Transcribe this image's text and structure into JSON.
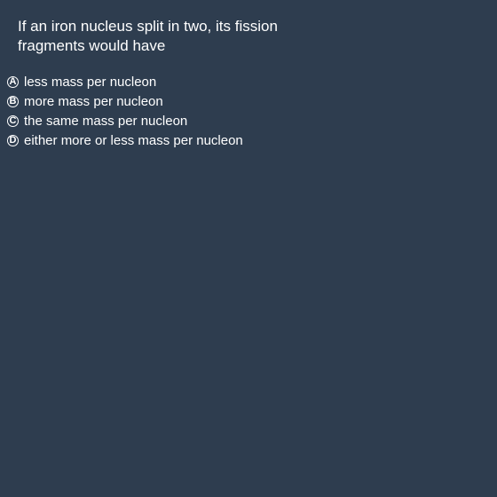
{
  "question": {
    "text": "If an iron nucleus split in two, its fission fragments would have"
  },
  "options": [
    {
      "letter": "A",
      "label": "less mass per nucleon"
    },
    {
      "letter": "B",
      "label": "more mass per nucleon"
    },
    {
      "letter": "C",
      "label": "the same mass per nucleon"
    },
    {
      "letter": "D",
      "label": "either more or less mass per nucleon"
    }
  ],
  "colors": {
    "background": "#2e3d4f",
    "text": "#ffffff"
  }
}
